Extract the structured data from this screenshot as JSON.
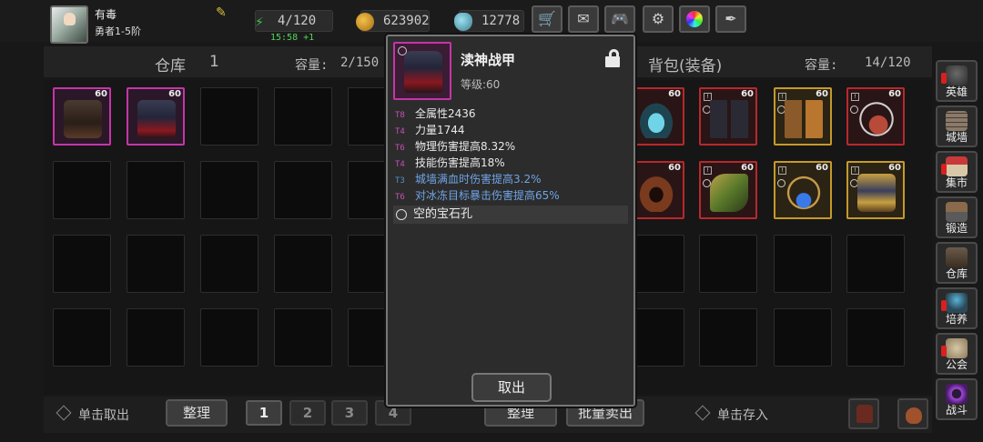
{
  "player": {
    "name": "有毒",
    "rank": "勇者1-5阶"
  },
  "resources": {
    "energy": "4/120",
    "timer": "15:58 +1",
    "gold": "623902",
    "gems": "12778"
  },
  "top_buttons": [
    {
      "name": "shop",
      "icon": "cart-icon"
    },
    {
      "name": "mail",
      "icon": "mail-icon"
    },
    {
      "name": "gamepad",
      "icon": "gamepad-icon"
    },
    {
      "name": "settings",
      "icon": "gear-icon"
    },
    {
      "name": "wheel",
      "icon": "color-wheel-icon"
    },
    {
      "name": "plume",
      "icon": "feather-icon"
    }
  ],
  "warehouse": {
    "title": "仓库",
    "page": "1",
    "capacity_label": "容量:",
    "capacity": "2/150"
  },
  "bag": {
    "title": "背包(装备)",
    "capacity_label": "容量:",
    "capacity": "14/120"
  },
  "item_level": "60",
  "warehouse_items": [
    {
      "art": "cloak-armor",
      "level": "60"
    },
    {
      "art": "demon-armor",
      "level": "60"
    }
  ],
  "bag_items_row1": [
    {
      "art": "crown",
      "level": "60"
    },
    {
      "art": "boots-dark",
      "level": "60"
    },
    {
      "art": "boots-gold",
      "level": "60"
    },
    {
      "art": "necklace",
      "level": "60"
    }
  ],
  "bag_items_row2": [
    {
      "art": "hood",
      "level": "60"
    },
    {
      "art": "cape-green",
      "level": "60"
    },
    {
      "art": "amulet-blue",
      "level": "60"
    },
    {
      "art": "armor-gold",
      "level": "60"
    }
  ],
  "bottom": {
    "take_out_single": "单击取出",
    "sort": "整理",
    "pages": [
      "1",
      "2",
      "3",
      "4"
    ],
    "bulk_sell": "批量卖出",
    "store_single": "单击存入"
  },
  "nav": [
    {
      "label": "英雄",
      "icon": "helmet-icon",
      "alert": true
    },
    {
      "label": "城墙",
      "icon": "wall-icon",
      "alert": false
    },
    {
      "label": "集市",
      "icon": "market-icon",
      "alert": true
    },
    {
      "label": "锻造",
      "icon": "anvil-icon",
      "alert": false
    },
    {
      "label": "仓库",
      "icon": "warehouse-icon",
      "alert": false
    },
    {
      "label": "培养",
      "icon": "trophy-icon",
      "alert": true
    },
    {
      "label": "公会",
      "icon": "guild-icon",
      "alert": true
    },
    {
      "label": "战斗",
      "icon": "portal-icon",
      "alert": false
    }
  ],
  "tooltip": {
    "item_name": "渎神战甲",
    "level": "等级:60",
    "stats": [
      {
        "tier": "T8",
        "text": "全属性2436",
        "tier_color": "#c74fb4",
        "blue": false
      },
      {
        "tier": "T4",
        "text": "力量1744",
        "tier_color": "#c74fb4",
        "blue": false
      },
      {
        "tier": "T6",
        "text": "物理伤害提高8.32%",
        "tier_color": "#c74fb4",
        "blue": false
      },
      {
        "tier": "T4",
        "text": "技能伤害提高18%",
        "tier_color": "#c74fb4",
        "blue": false
      },
      {
        "tier": "T3",
        "text": "城墙满血时伤害提高3.2%",
        "tier_color": "#4f90c7",
        "blue": true
      },
      {
        "tier": "T6",
        "text": "对冰冻目标暴击伤害提高65%",
        "tier_color": "#c74fb4",
        "blue": true
      }
    ],
    "socket": "空的宝石孔",
    "take_out_button": "取出"
  },
  "colors": {
    "epic_border": "#c535a8",
    "legend_border": "#c59a2a",
    "red_border": "#b8282c"
  }
}
